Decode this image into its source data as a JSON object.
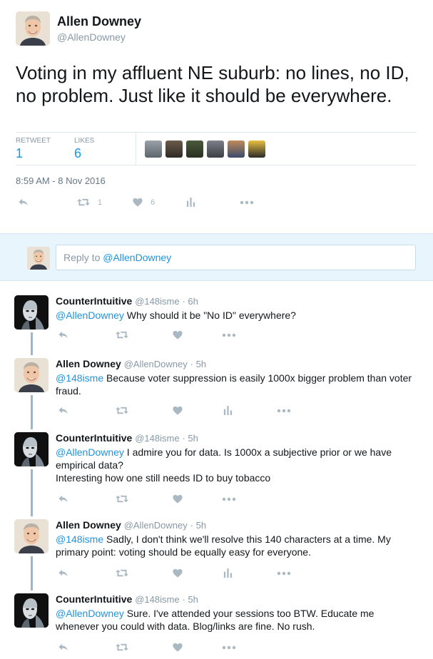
{
  "main_tweet": {
    "author_name": "Allen Downey",
    "author_handle": "@AllenDowney",
    "text": "Voting in my affluent NE suburb: no lines, no ID, no problem.  Just like it should be everywhere.",
    "stats": {
      "retweets_label": "RETWEET",
      "retweets_value": "1",
      "likes_label": "LIKES",
      "likes_value": "6"
    },
    "timestamp": "8:59 AM - 8 Nov 2016",
    "actions": {
      "retweet_count": "1",
      "like_count": "6"
    }
  },
  "reply_box": {
    "prefix": "Reply to ",
    "mention": "@AllenDowney"
  },
  "replies": [
    {
      "name": "CounterIntuitive",
      "handle": "@148isme",
      "time": "· 6h",
      "mention": "@AllenDowney",
      "text": " Why should it be \"No ID\" everywhere?"
    },
    {
      "name": "Allen Downey",
      "handle": "@AllenDowney",
      "time": "· 5h",
      "mention": "@148isme",
      "text": " Because voter suppression is easily 1000x bigger problem than voter fraud."
    },
    {
      "name": "CounterIntuitive",
      "handle": "@148isme",
      "time": "· 5h",
      "mention": "@AllenDowney",
      "text": " I admire you for data. Is 1000x a subjective prior or we have empirical data?",
      "text2": "Interesting how one still needs ID to buy tobacco"
    },
    {
      "name": "Allen Downey",
      "handle": "@AllenDowney",
      "time": "· 5h",
      "mention": "@148isme",
      "text": " Sadly, I don't think we'll resolve this 140 characters at a time.  My primary point: voting should be equally easy for everyone."
    },
    {
      "name": "CounterIntuitive",
      "handle": "@148isme",
      "time": "· 5h",
      "mention": "@AllenDowney",
      "text": " Sure. I've attended your sessions too BTW. Educate me whenever you could with data. Blog/links are fine. No rush."
    }
  ],
  "colors": {
    "link": "#1b95e0",
    "muted": "#8899a6",
    "action_icon": "#aab8c2",
    "thread_line": "#9ab8cd",
    "reply_area_bg": "#e8f5fd"
  },
  "icons": [
    "reply-icon",
    "retweet-icon",
    "heart-icon",
    "analytics-icon",
    "more-icon"
  ]
}
